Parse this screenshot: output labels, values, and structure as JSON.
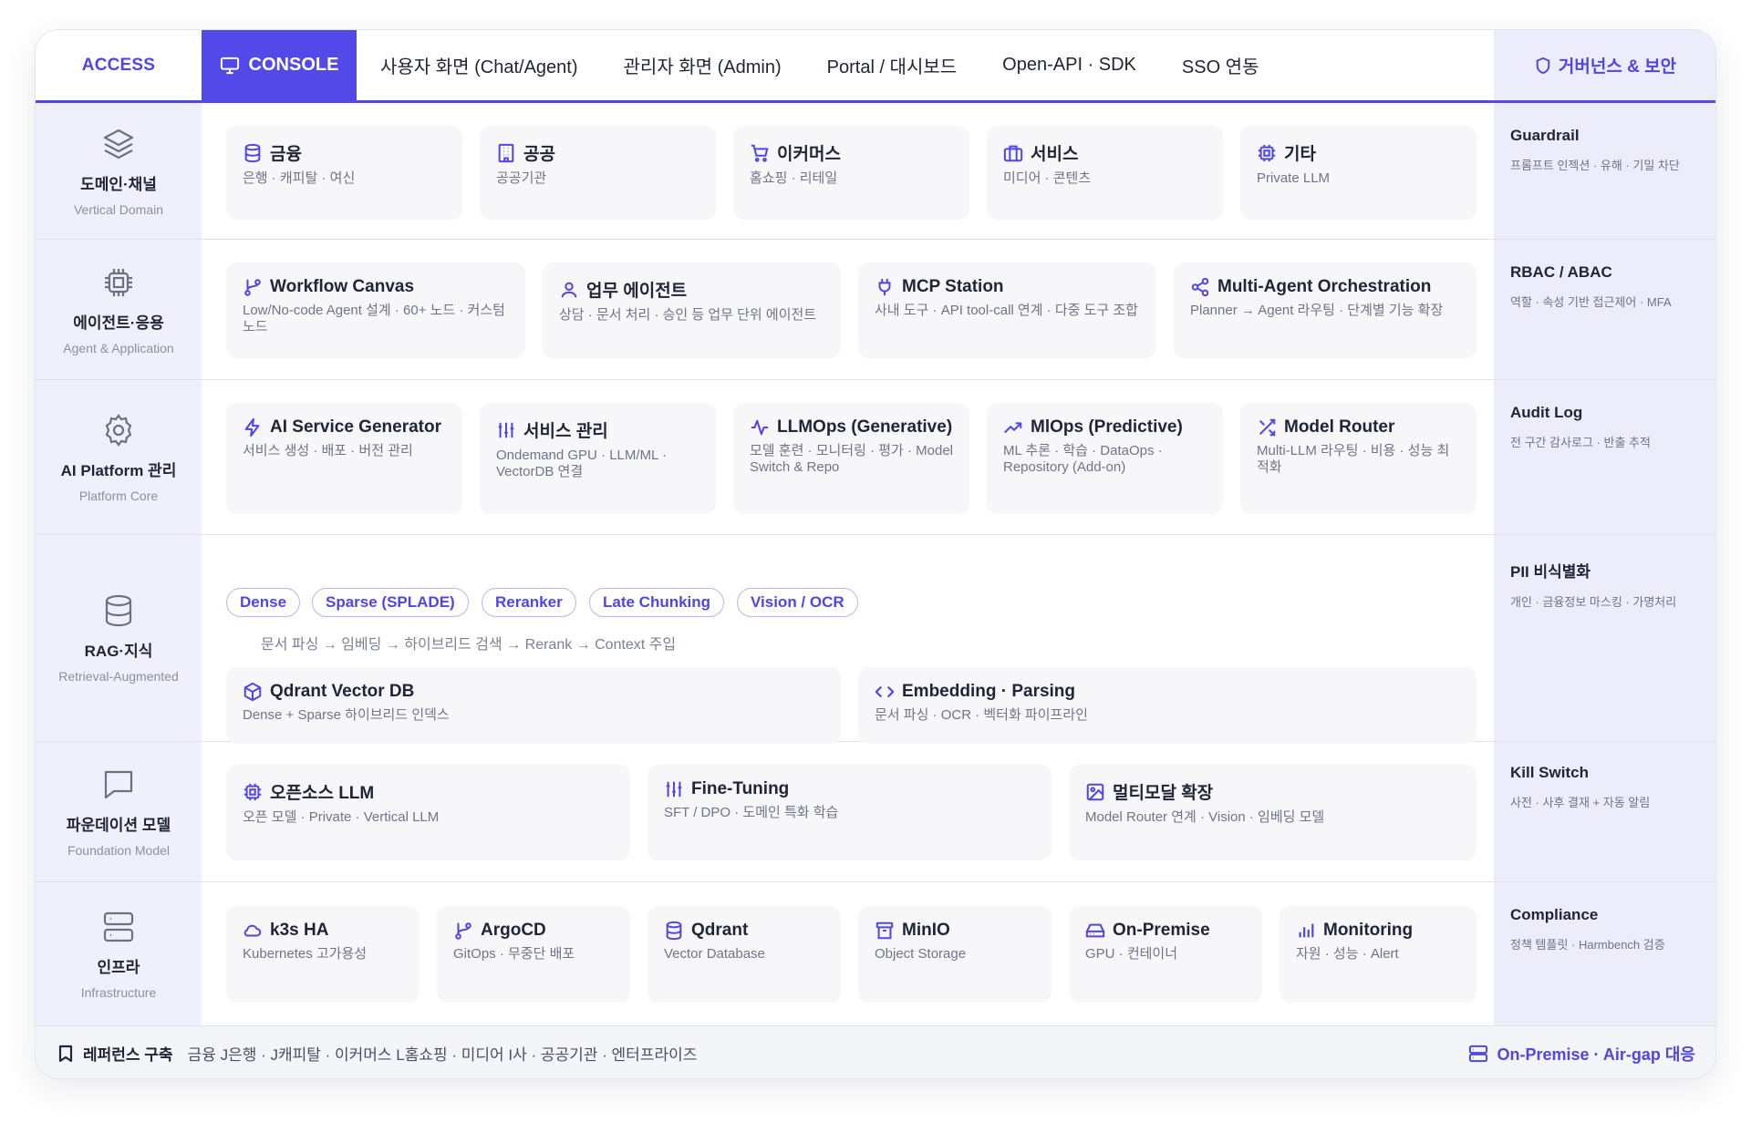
{
  "header": {
    "access_label": "ACCESS",
    "console_label": "CONSOLE",
    "tabs": [
      "사용자 화면 (Chat/Agent)",
      "관리자 화면 (Admin)",
      "Portal / 대시보드",
      "Open-API · SDK",
      "SSO 연동"
    ],
    "governance_label": "거버넌스 & 보안"
  },
  "layers": [
    {
      "title": "도메인·채널",
      "sub": "Vertical Domain",
      "icon": "layers-icon"
    },
    {
      "title": "에이전트·응용",
      "sub": "Agent & Application",
      "icon": "chip-icon"
    },
    {
      "title": "AI Platform 관리",
      "sub": "Platform Core",
      "icon": "gear-icon"
    },
    {
      "title": "RAG·지식",
      "sub": "Retrieval-Augmented",
      "icon": "database-icon"
    },
    {
      "title": "파운데이션 모델",
      "sub": "Foundation Model",
      "icon": "chat-icon"
    },
    {
      "title": "인프라",
      "sub": "Infrastructure",
      "icon": "server-icon"
    }
  ],
  "governance": [
    {
      "title": "Guardrail",
      "sub": "프롬프트 인젝션 · 유해 · 기밀 차단"
    },
    {
      "title": "RBAC / ABAC",
      "sub": "역할 · 속성 기반 접근제어 · MFA"
    },
    {
      "title": "Audit Log",
      "sub": "전 구간 감사로그 · 반출 추적"
    },
    {
      "title": "PII 비식별화",
      "sub": "개인 · 금융정보 마스킹 · 가명처리"
    },
    {
      "title": "Kill Switch",
      "sub": "사전 · 사후 결재 + 자동 알림"
    },
    {
      "title": "Compliance",
      "sub": "정책 템플릿 · Harmbench 검증"
    }
  ],
  "domain_cards": [
    {
      "title": "금융",
      "sub": "은행 · 캐피탈 · 여신",
      "icon": "database-icon"
    },
    {
      "title": "공공",
      "sub": "공공기관",
      "icon": "building-icon"
    },
    {
      "title": "이커머스",
      "sub": "홈쇼핑 · 리테일",
      "icon": "cart-icon"
    },
    {
      "title": "서비스",
      "sub": "미디어 · 콘텐츠",
      "icon": "briefcase-icon"
    },
    {
      "title": "기타",
      "sub": "Private LLM",
      "icon": "cpu-icon"
    }
  ],
  "agent_cards": [
    {
      "title": "Workflow Canvas",
      "sub": "Low/No-code Agent 설계 · 60+ 노드 · 커스텀 노드",
      "icon": "branch-icon"
    },
    {
      "title": "업무 에이전트",
      "sub": "상담 · 문서 처리 · 승인 등 업무 단위 에이전트",
      "icon": "user-icon"
    },
    {
      "title": "MCP Station",
      "sub": "사내 도구 · API tool-call 연계 · 다중 도구 조합",
      "icon": "plug-icon"
    },
    {
      "title": "Multi-Agent Orchestration",
      "sub": "Planner → Agent 라우팅 · 단계별 기능 확장",
      "icon": "share-icon"
    }
  ],
  "platform_cards": [
    {
      "title": "AI Service Generator",
      "sub": "서비스 생성 · 배포 · 버전 관리",
      "icon": "bolt-icon"
    },
    {
      "title": "서비스 관리",
      "sub": "Ondemand GPU · LLM/ML · VectorDB 연결",
      "icon": "sliders-icon"
    },
    {
      "title": "LLMOps (Generative)",
      "sub": "모델 훈련 · 모니터링 · 평가 · Model Switch & Repo",
      "icon": "pulse-icon"
    },
    {
      "title": "MlOps (Predictive)",
      "sub": "ML 추론 · 학습 · DataOps · Repository (Add-on)",
      "icon": "trend-icon"
    },
    {
      "title": "Model Router",
      "sub": "Multi-LLM 라우팅 · 비용 · 성능 최적화",
      "icon": "shuffle-icon"
    }
  ],
  "rag": {
    "chips": [
      "Dense",
      "Sparse (SPLADE)",
      "Reranker",
      "Late Chunking",
      "Vision / OCR"
    ],
    "flow": "문서 파싱 → 임베딩 → 하이브리드 검색 → Rerank → Context 주입",
    "cards": [
      {
        "title": "Qdrant Vector DB",
        "sub": "Dense + Sparse 하이브리드 인덱스",
        "icon": "cube-icon"
      },
      {
        "title": "Embedding · Parsing",
        "sub": "문서 파싱 · OCR · 벡터화 파이프라인",
        "icon": "code-icon"
      }
    ]
  },
  "foundation_cards": [
    {
      "title": "오픈소스 LLM",
      "sub": "오픈 모델 · Private · Vertical LLM",
      "icon": "cpu-icon"
    },
    {
      "title": "Fine-Tuning",
      "sub": "SFT / DPO · 도메인 특화 학습",
      "icon": "sliders-icon"
    },
    {
      "title": "멀티모달 확장",
      "sub": "Model Router 연계 · Vision · 임베딩 모델",
      "icon": "image-icon"
    }
  ],
  "infra_cards": [
    {
      "title": "k3s HA",
      "sub": "Kubernetes 고가용성",
      "icon": "cloud-icon"
    },
    {
      "title": "ArgoCD",
      "sub": "GitOps · 무중단 배포",
      "icon": "branch-icon"
    },
    {
      "title": "Qdrant",
      "sub": "Vector Database",
      "icon": "database-icon"
    },
    {
      "title": "MinIO",
      "sub": "Object Storage",
      "icon": "archive-icon"
    },
    {
      "title": "On-Premise",
      "sub": "GPU · 컨테이너",
      "icon": "drive-icon"
    },
    {
      "title": "Monitoring",
      "sub": "자원 · 성능 · Alert",
      "icon": "bars-icon"
    }
  ],
  "footer": {
    "label": "레퍼런스 구축",
    "text": "금융 J은행 · J캐피탈 · 이커머스 L홈쇼핑 · 미디어 I사 · 공공기관 · 엔터프라이즈",
    "right": "On-Premise · Air-gap 대응"
  }
}
